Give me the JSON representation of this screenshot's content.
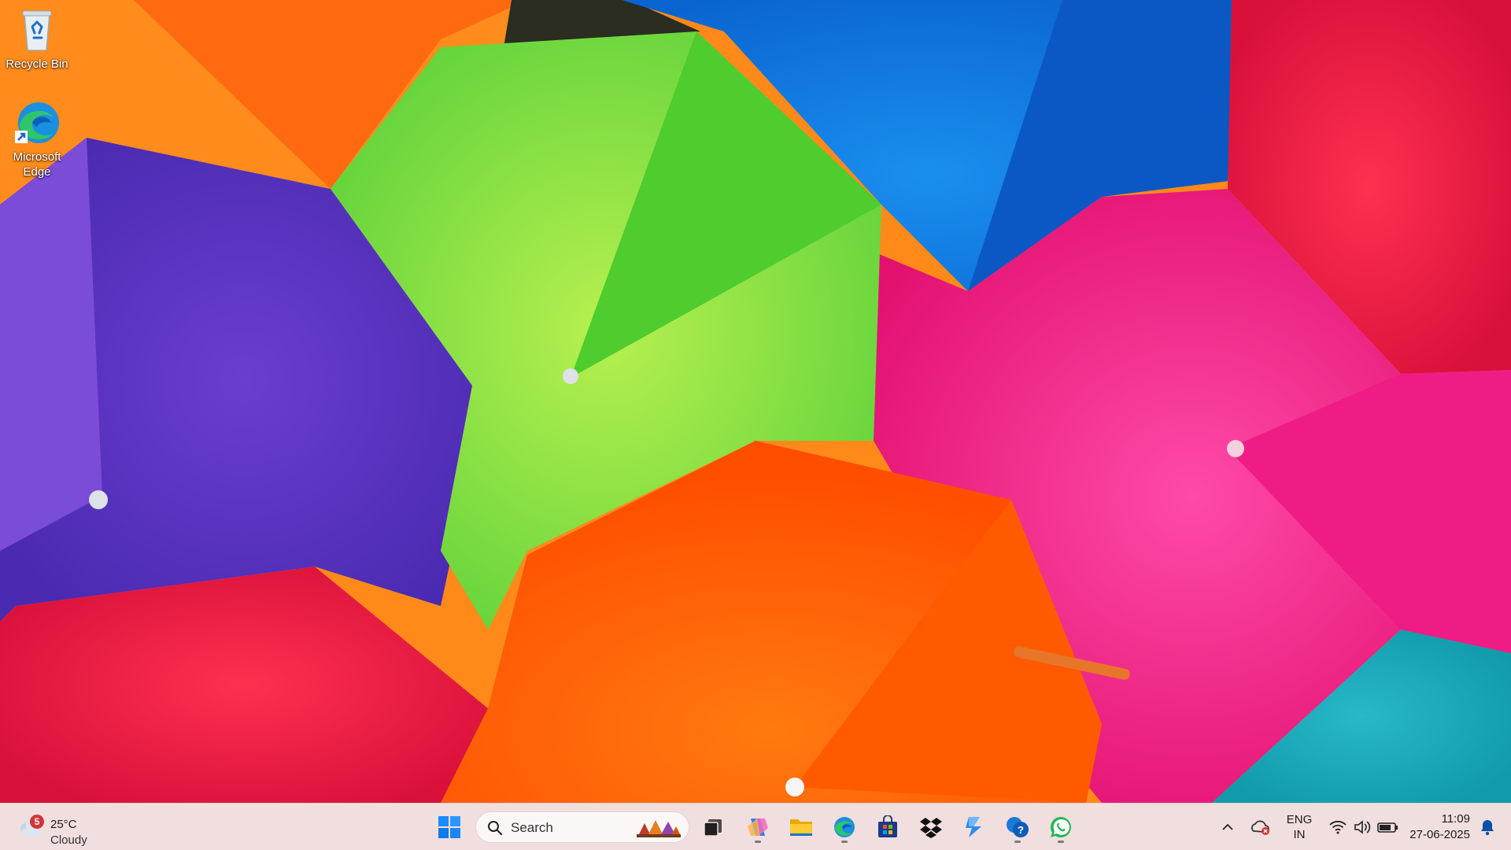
{
  "desktop": {
    "icons": [
      {
        "label": "Recycle Bin",
        "icon": "recycle-bin-icon"
      },
      {
        "label": "Microsoft Edge",
        "icon": "edge-icon"
      }
    ],
    "wallpaper": "colorful-umbrellas"
  },
  "taskbar": {
    "weather": {
      "temperature": "25°C",
      "condition": "Cloudy",
      "badge_count": "5"
    },
    "search": {
      "placeholder": "Search"
    },
    "pinned_apps": [
      {
        "name": "Start",
        "icon": "windows-start-icon"
      },
      {
        "name": "Task View",
        "icon": "task-view-icon"
      },
      {
        "name": "Copilot",
        "icon": "copilot-icon"
      },
      {
        "name": "File Explorer",
        "icon": "file-explorer-icon"
      },
      {
        "name": "Microsoft Edge",
        "icon": "edge-icon"
      },
      {
        "name": "Microsoft Store",
        "icon": "store-icon"
      },
      {
        "name": "Dropbox",
        "icon": "dropbox-icon"
      },
      {
        "name": "Power Automate",
        "icon": "power-automate-icon"
      },
      {
        "name": "Get Help",
        "icon": "get-help-icon"
      },
      {
        "name": "WhatsApp",
        "icon": "whatsapp-icon"
      }
    ],
    "tray": {
      "language_line1": "ENG",
      "language_line2": "IN",
      "time": "11:09",
      "date": "27-06-2025"
    }
  },
  "colors": {
    "taskbar_bg": "#f1dedf",
    "accent": "#0078d4",
    "badge": "#d13438"
  }
}
